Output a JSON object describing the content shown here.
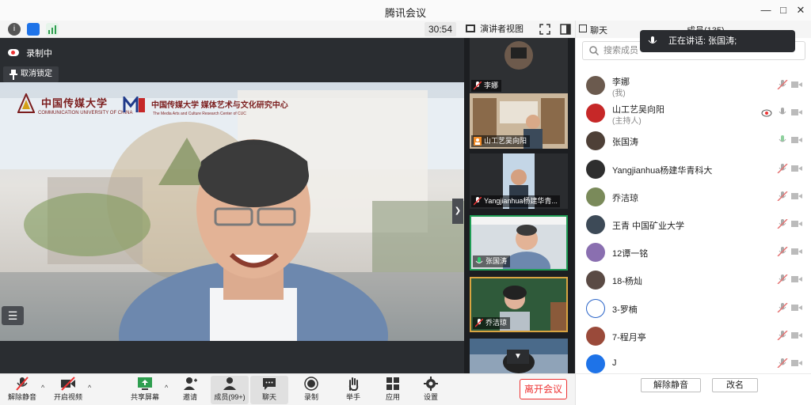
{
  "window": {
    "title": "腾讯会议"
  },
  "toolbar": {
    "timer": "30:54",
    "view_label": "演讲者视图"
  },
  "main_video": {
    "recording_label": "录制中",
    "unlock_label": "取消锁定",
    "logo_left_text": "中国传媒大学",
    "logo_left_sub": "COMMUNICATION UNIVERSITY OF CHINA",
    "logo_right_text": "中国传媒大学 媒体艺术与文化研究中心",
    "logo_right_sub": "The Media Arts and Culture Research Center of CUC"
  },
  "thumbnails": [
    {
      "name": "李娜"
    },
    {
      "name": "山工艺吴向阳"
    },
    {
      "name": "Yangjianhua杨建华青..."
    },
    {
      "name": "张国涛"
    },
    {
      "name": "乔洁琼"
    }
  ],
  "bottom_toolbar": {
    "unmute": "解除静音",
    "start_video": "开启视频",
    "share_screen": "共享屏幕",
    "invite": "邀请",
    "members": "成员(99+)",
    "chat": "聊天",
    "record": "录制",
    "raise_hand": "举手",
    "apps": "应用",
    "settings": "设置",
    "leave": "离开会议"
  },
  "right_panel": {
    "chat_tab": "聊天",
    "members_tab": "成员(135)",
    "search_placeholder": "搜索成员",
    "members": [
      {
        "name": "李娜",
        "sub": "(我)",
        "color": "#6b5a4e"
      },
      {
        "name": "山工艺吴向阳",
        "sub": "(主持人)",
        "color": "#c62828"
      },
      {
        "name": "张国涛",
        "sub": "",
        "color": "#4e4037"
      },
      {
        "name": "Yangjianhua杨建华青科大",
        "sub": "",
        "color": "#2e2e2e"
      },
      {
        "name": "乔洁琼",
        "sub": "",
        "color": "#7a8a5a"
      },
      {
        "name": "王青  中国矿业大学",
        "sub": "",
        "color": "#3d4a57"
      },
      {
        "name": "12谭一铭",
        "sub": "",
        "color": "#8a6fb0"
      },
      {
        "name": "18-杨灿",
        "sub": "",
        "color": "#5a4a44"
      },
      {
        "name": "3-罗楠",
        "sub": "",
        "color": "#ffffff"
      },
      {
        "name": "7-程月亭",
        "sub": "",
        "color": "#9a4a3a"
      },
      {
        "name": "J",
        "sub": "",
        "color": "#1e73e8"
      }
    ],
    "unmute_all": "解除静音",
    "rename": "改名"
  },
  "toast": {
    "text": "正在讲话: 张国涛;"
  }
}
